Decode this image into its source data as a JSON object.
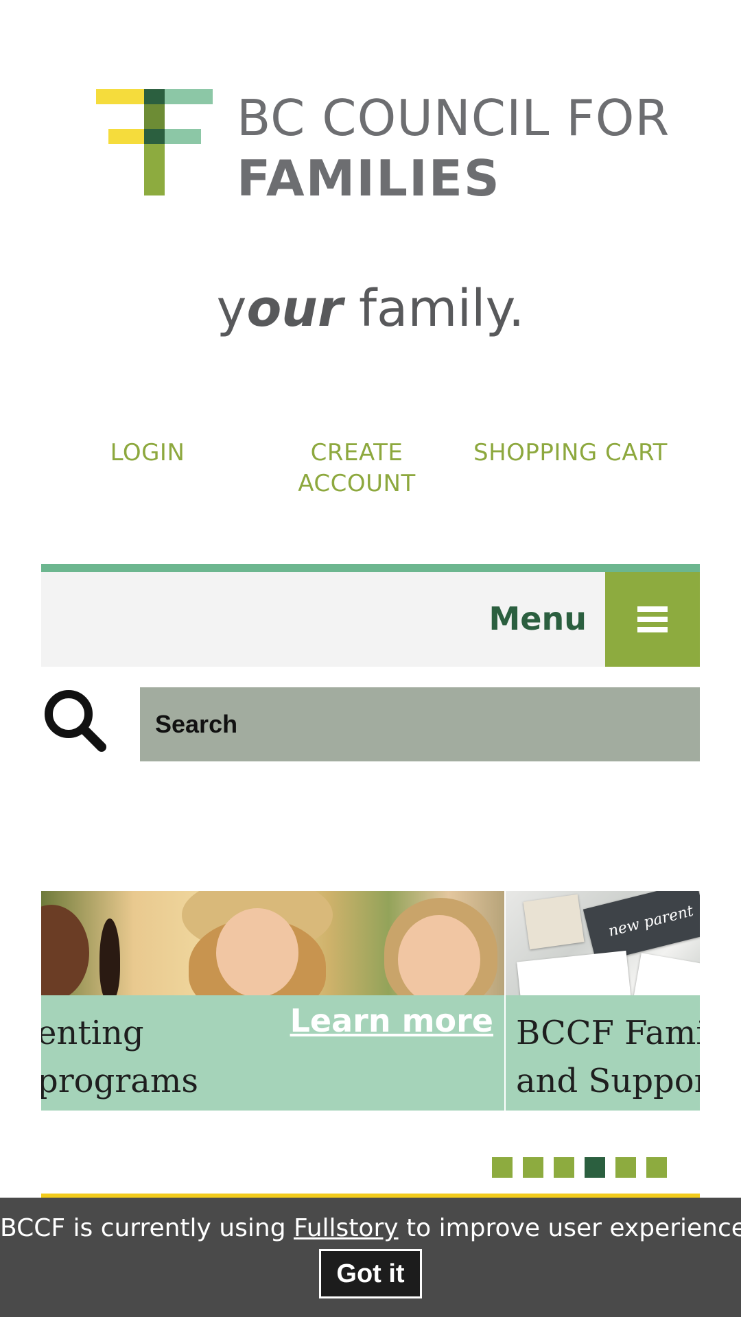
{
  "brand": {
    "logo_line_1": "BC COUNCIL FOR",
    "logo_line_2": "FAMILIES",
    "logo_colors": [
      "#f5dc3c",
      "#8dab3f",
      "#2b5f3f",
      "#8cc7a6"
    ]
  },
  "tagline": {
    "part_1": "y",
    "part_2": "our",
    "part_3": " family."
  },
  "account_nav": {
    "login": "LOGIN",
    "create_account_line_1": "CREATE",
    "create_account_line_2": "ACCOUNT",
    "shopping_cart": "SHOPPING CART"
  },
  "main_nav": {
    "menu_label": "Menu",
    "menu_icon": "hamburger-icon"
  },
  "search": {
    "icon": "search-icon",
    "placeholder": "Search"
  },
  "carousel": {
    "slides": [
      {
        "caption_line_1": "enting",
        "caption_line_2": "programs",
        "link": "Learn more"
      },
      {
        "caption_line_1": "BCCF Famil",
        "caption_line_2": "and Suppor",
        "image_text": "new parent"
      }
    ],
    "dots_count": 6,
    "active_dot": 4
  },
  "cookie_banner": {
    "text_before": "BCCF is currently using ",
    "link": "Fullstory",
    "text_after": " to improve user experience.",
    "button": "Got it"
  },
  "colors": {
    "accent_green": "#8dab3f",
    "dark_green": "#2b5f3f",
    "mint": "#a5d3b9",
    "menu_line": "#6cb68f",
    "yellow": "#f2cb1c",
    "banner_bg": "#4a4a4a"
  }
}
